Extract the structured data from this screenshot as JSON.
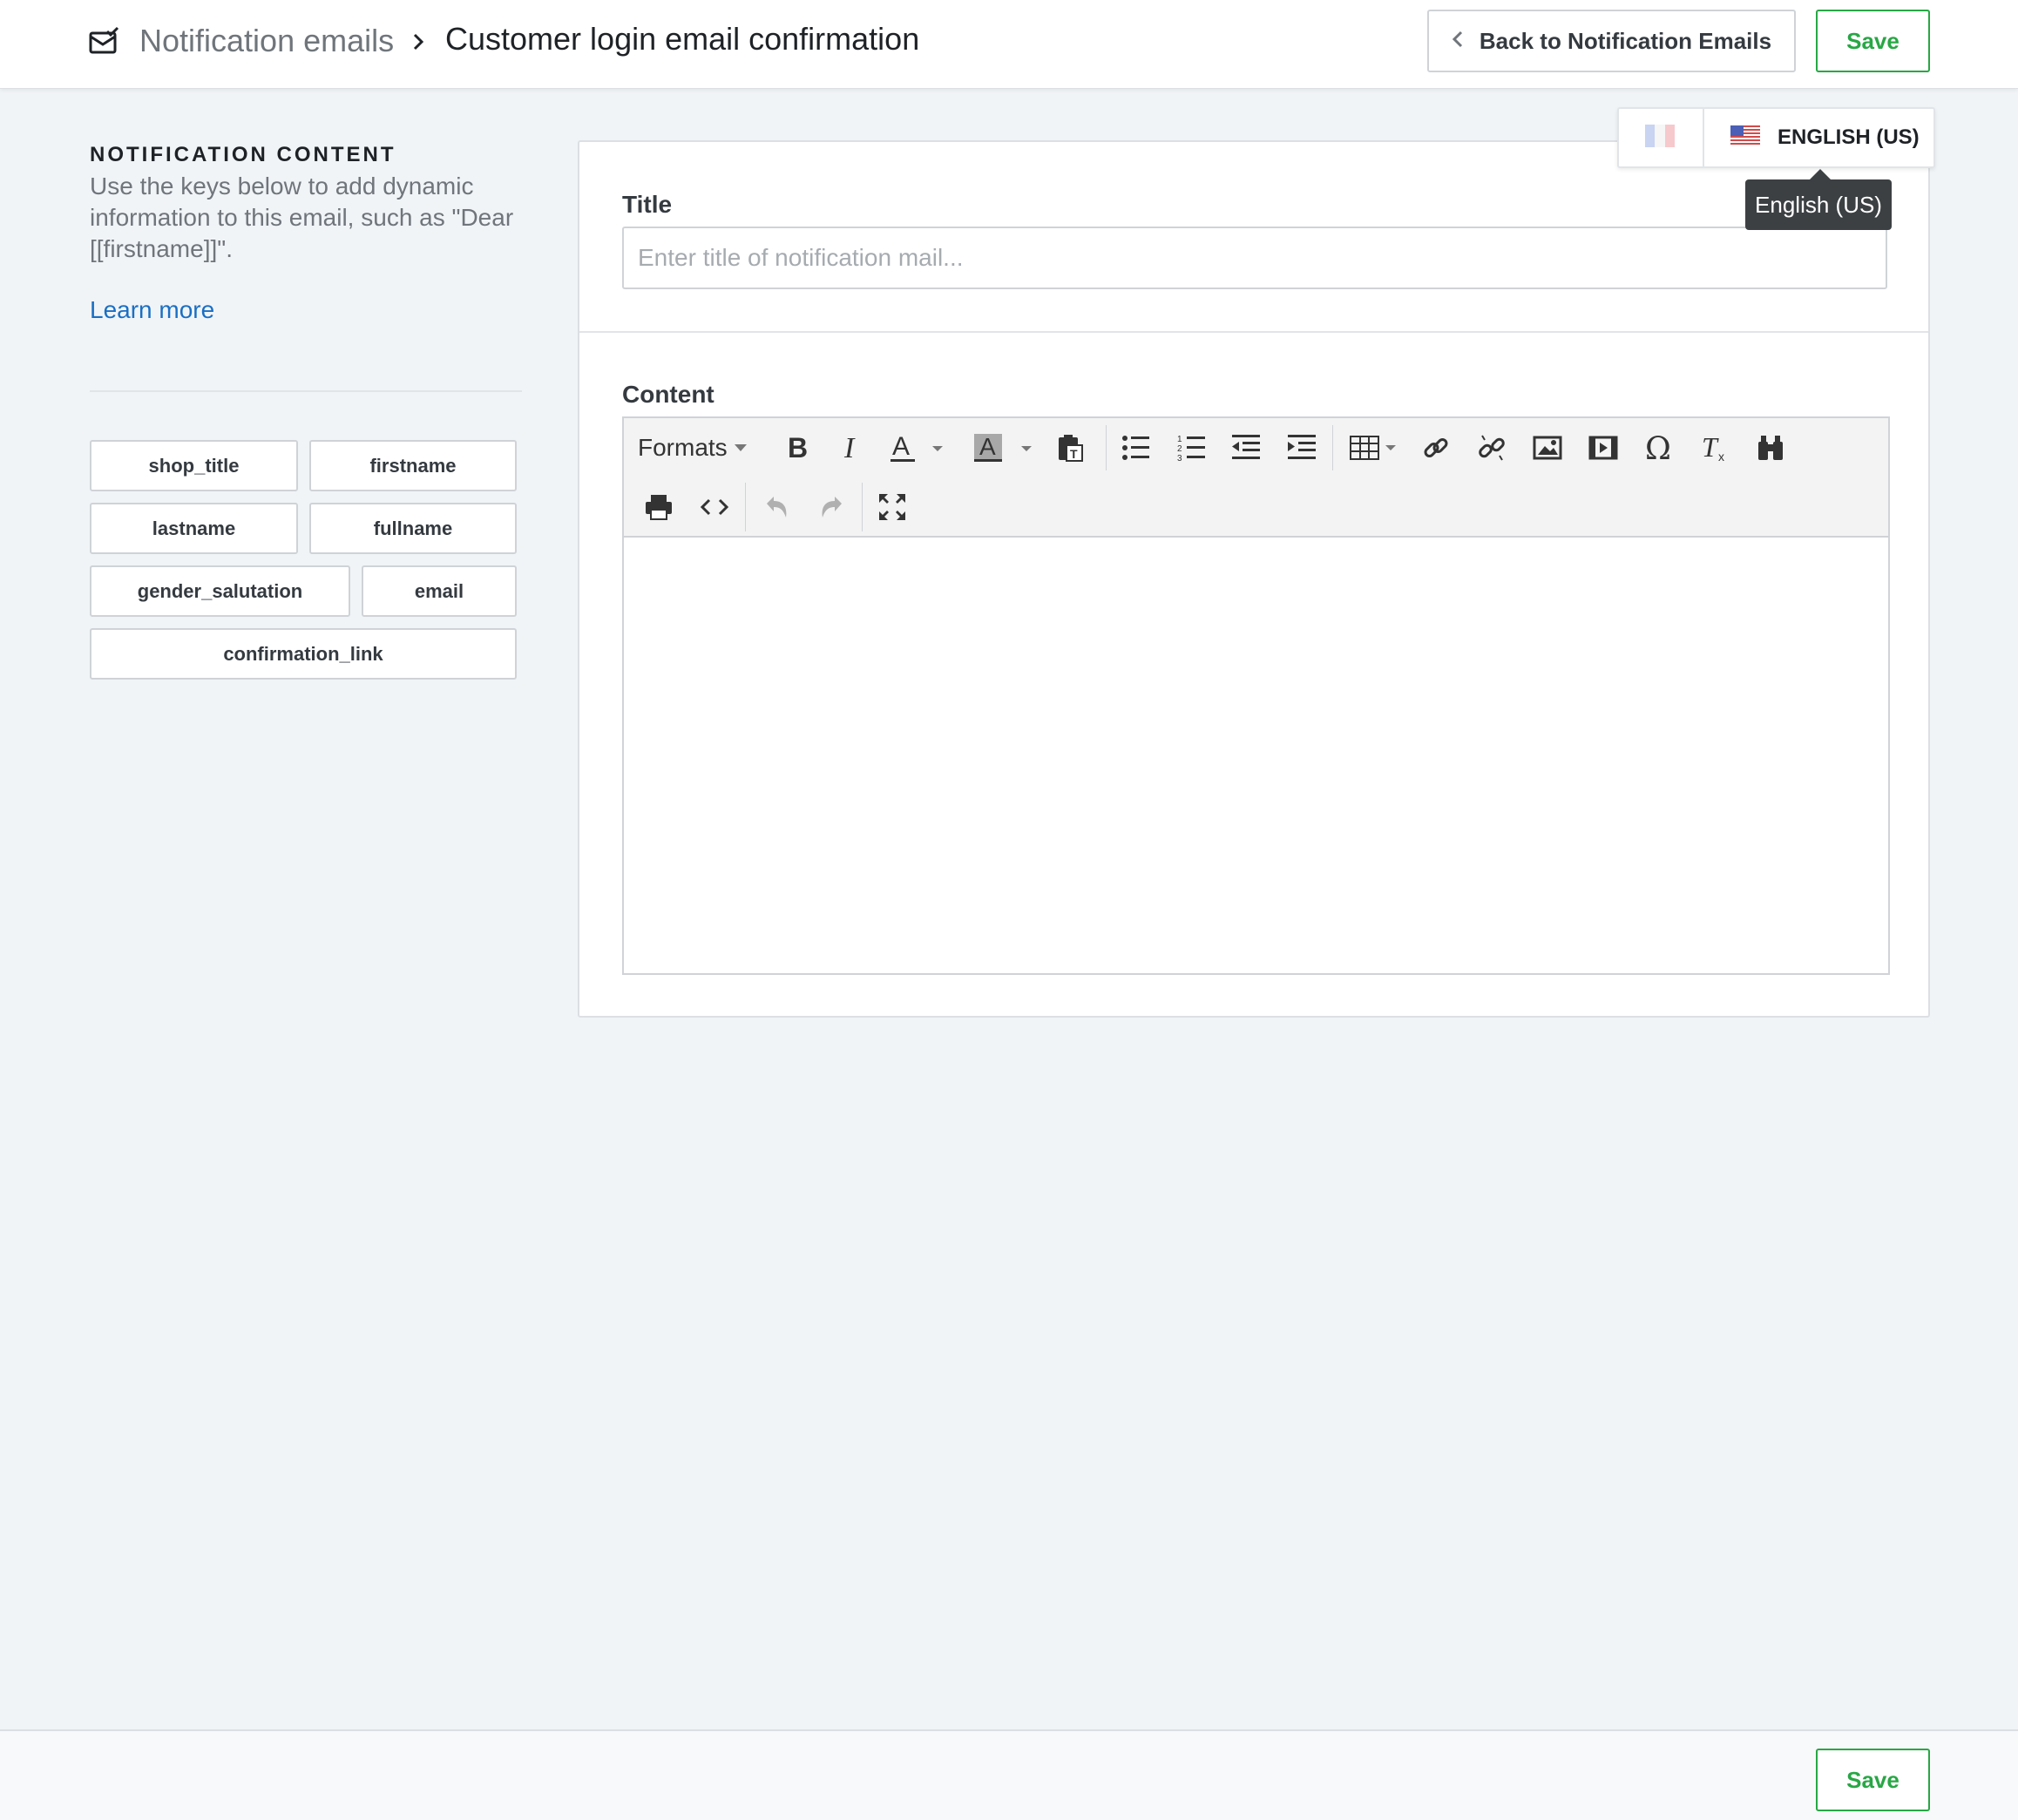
{
  "header": {
    "breadcrumb_icon": "envelope-check-icon",
    "parent": "Notification emails",
    "separator_icon": "chevron-right-icon",
    "current": "Customer login email confirmation",
    "back_button": "Back to Notification Emails",
    "save_button": "Save"
  },
  "sidebar": {
    "heading": "NOTIFICATION CONTENT",
    "description": "Use the keys below to add dynamic information to this email, such as \"Dear [[firstname]]\".",
    "learn_more": "Learn more",
    "keys": [
      "shop_title",
      "firstname",
      "lastname",
      "fullname",
      "gender_salutation",
      "email",
      "confirmation_link"
    ]
  },
  "form": {
    "title_label": "Title",
    "title_value": "",
    "title_placeholder": "Enter title of notification mail...",
    "content_label": "Content",
    "content_value": ""
  },
  "editor_toolbar": {
    "formats_label": "Formats",
    "row1": [
      "bold-icon",
      "italic-icon",
      "text-color-icon",
      "background-color-icon",
      "paste-text-icon",
      "bullet-list-icon",
      "numbered-list-icon",
      "outdent-icon",
      "indent-icon",
      "table-icon",
      "link-icon",
      "unlink-icon",
      "image-icon",
      "media-icon",
      "special-character-icon",
      "clear-formatting-icon",
      "find-replace-icon"
    ],
    "row2": [
      "print-icon",
      "source-code-icon",
      "undo-icon",
      "redo-icon",
      "fullscreen-icon"
    ]
  },
  "language": {
    "options": [
      {
        "flag": "flag-fr-icon",
        "label": ""
      },
      {
        "flag": "flag-us-icon",
        "label": "ENGLISH (US)"
      }
    ],
    "selected": "ENGLISH (US)",
    "tooltip": "English (US)"
  },
  "footer": {
    "save_button": "Save"
  },
  "colors": {
    "save_green": "#28a745",
    "link_blue": "#1a6fc4",
    "page_background": "#f1f4f7",
    "tooltip_background": "#3c4043"
  }
}
